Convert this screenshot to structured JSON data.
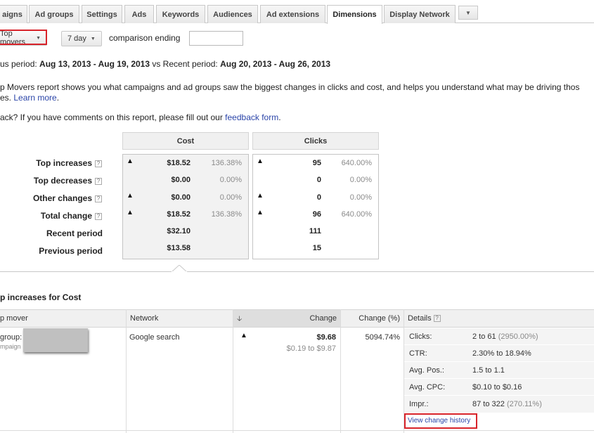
{
  "tabs": [
    {
      "label": "aigns"
    },
    {
      "label": "Ad groups"
    },
    {
      "label": "Settings"
    },
    {
      "label": "Ads"
    },
    {
      "label": "Keywords"
    },
    {
      "label": "Audiences"
    },
    {
      "label": "Ad extensions"
    },
    {
      "label": "Dimensions"
    },
    {
      "label": "Display Network"
    }
  ],
  "controls": {
    "view_label": "Top movers",
    "period_label": "7 day",
    "comparison_label": "comparison ending",
    "comparison_value": ""
  },
  "period_line": {
    "prefix": "us period: ",
    "previous": "Aug 13, 2013 - Aug 19, 2013",
    "vs": " vs Recent period: ",
    "recent": "Aug 20, 2013 - Aug 26, 2013"
  },
  "description": {
    "line1": "p Movers report shows you what campaigns and ad groups saw the biggest changes in clicks and cost, and helps you understand what may be driving thos",
    "line2_prefix": "es. ",
    "learn_more": "Learn more",
    "line2_suffix": "."
  },
  "feedback": {
    "prefix": "ack? If you have comments on this report, please fill out our ",
    "link": "feedback form",
    "suffix": "."
  },
  "summary": {
    "cost_header": "Cost",
    "clicks_header": "Clicks",
    "row_labels": {
      "top_increases": "Top increases",
      "top_decreases": "Top decreases",
      "other_changes": "Other changes",
      "total_change": "Total change",
      "recent_period": "Recent period",
      "previous_period": "Previous period"
    },
    "cost": {
      "top_increases": {
        "value": "$18.52",
        "pct": "136.38%",
        "arrow": "up"
      },
      "top_decreases": {
        "value": "$0.00",
        "pct": "0.00%"
      },
      "other_changes": {
        "value": "$0.00",
        "pct": "0.00%",
        "arrow": "up"
      },
      "total_change": {
        "value": "$18.52",
        "pct": "136.38%",
        "arrow": "up"
      },
      "recent_period": {
        "value": "$32.10"
      },
      "previous_period": {
        "value": "$13.58"
      }
    },
    "clicks": {
      "top_increases": {
        "value": "95",
        "pct": "640.00%",
        "arrow": "up"
      },
      "top_decreases": {
        "value": "0",
        "pct": "0.00%"
      },
      "other_changes": {
        "value": "0",
        "pct": "0.00%",
        "arrow": "up"
      },
      "total_change": {
        "value": "96",
        "pct": "640.00%",
        "arrow": "up"
      },
      "recent_period": {
        "value": "111"
      },
      "previous_period": {
        "value": "15"
      }
    }
  },
  "section_title": "p increases for Cost",
  "table": {
    "headers": {
      "mover": "p mover",
      "network": "Network",
      "change": "Change",
      "change_pct": "Change (%)",
      "details": "Details"
    },
    "row": {
      "mover_line1": "group:",
      "mover_line2": "mpaign",
      "network": "Google search",
      "change_value": "$9.68",
      "change_range": "$0.19 to $9.87",
      "change_pct": "5094.74%",
      "details": [
        {
          "label": "Clicks:",
          "value": "2 to 61",
          "extra": "(2950.00%)"
        },
        {
          "label": "CTR:",
          "value": "2.30% to 18.94%",
          "extra": ""
        },
        {
          "label": "Avg. Pos.:",
          "value": "1.5 to 1.1",
          "extra": ""
        },
        {
          "label": "Avg. CPC:",
          "value": "$0.10 to $0.16",
          "extra": ""
        },
        {
          "label": "Impr.:",
          "value": "87 to 322",
          "extra": "(270.11%)"
        }
      ],
      "view_history": "View change history"
    }
  }
}
